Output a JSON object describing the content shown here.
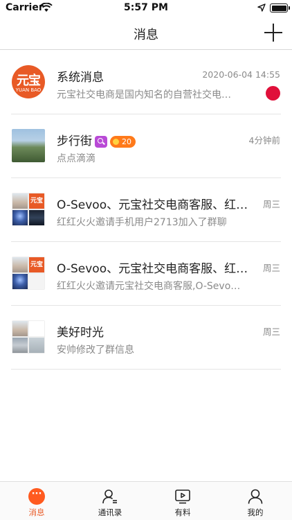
{
  "status_bar": {
    "carrier": "Carrier",
    "time": "5:57 PM"
  },
  "nav": {
    "title": "消息"
  },
  "conversations": [
    {
      "title": "系统消息",
      "time": "2020-06-04 14:55",
      "preview": "元宝社交电商是国内知名的自营社交电商平台",
      "avatar_text": "元宝",
      "avatar_subtext": "YUAN BAO",
      "unread": true
    },
    {
      "title": "步行街",
      "time": "4分钟前",
      "preview": "点点滴滴",
      "level": "20"
    },
    {
      "title": "O-Sevoo、元宝社交电商客服、红红火火",
      "time": "周三",
      "preview": "红红火火邀请手机用户2713加入了群聊",
      "tile_text": "元宝"
    },
    {
      "title": "O-Sevoo、元宝社交电商客服、红红火火",
      "time": "周三",
      "preview": "红红火火邀请元宝社交电商客服,O-Sevoo加入了群聊",
      "tile_text": "元宝"
    },
    {
      "title": "美好时光",
      "time": "周三",
      "preview": "安帅修改了群信息"
    }
  ],
  "tabs": [
    {
      "label": "消息",
      "icon": "chat-bubble-icon",
      "active": true
    },
    {
      "label": "通讯录",
      "icon": "contacts-icon"
    },
    {
      "label": "有料",
      "icon": "video-icon"
    },
    {
      "label": "我的",
      "icon": "person-icon"
    }
  ],
  "colors": {
    "accent": "#e85a26",
    "unread": "#e0103a",
    "badge_purple": "#b94ad6",
    "badge_orange": "#ff7a1a"
  }
}
